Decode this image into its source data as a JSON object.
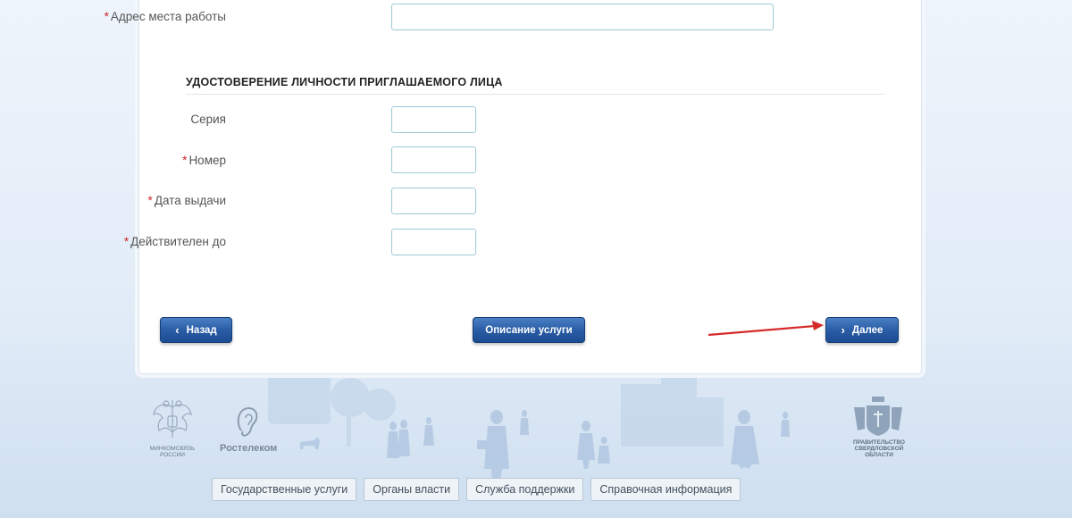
{
  "form": {
    "work_address": {
      "label": "Адрес места работы",
      "required": true,
      "value": ""
    },
    "section_title": "УДОСТОВЕРЕНИЕ ЛИЧНОСТИ ПРИГЛАШАЕМОГО ЛИЦА",
    "series": {
      "label": "Серия",
      "required": false,
      "value": ""
    },
    "number": {
      "label": "Номер",
      "required": true,
      "value": ""
    },
    "issue_date": {
      "label": "Дата выдачи",
      "required": true,
      "value": ""
    },
    "valid_until": {
      "label": "Действителен до",
      "required": true,
      "value": ""
    }
  },
  "buttons": {
    "back": "Назад",
    "service_description": "Описание услуги",
    "next": "Далее"
  },
  "footer": {
    "ministry_logo_text": "МИНКОМСВЯЗЬ РОССИИ",
    "rostelecom": "Ростелеком",
    "gov_logo_text": "ПРАВИТЕЛЬСТВО СВЕРДЛОВСКОЙ ОБЛАСТИ",
    "links": [
      "Государственные услуги",
      "Органы власти",
      "Служба поддержки",
      "Справочная информация"
    ]
  },
  "colors": {
    "accent_button": "#2a5da6",
    "required_mark": "#d0222d",
    "input_border": "#9fc7d7",
    "annotation_arrow": "#d42a2a"
  },
  "icons": {
    "back": "chevron-left-icon",
    "next": "chevron-right-icon",
    "ministry": "russian-eagle-emblem-icon",
    "rostelecom": "rostelecom-ear-icon",
    "sverdlovsk": "sverdlovsk-coat-of-arms-icon"
  }
}
